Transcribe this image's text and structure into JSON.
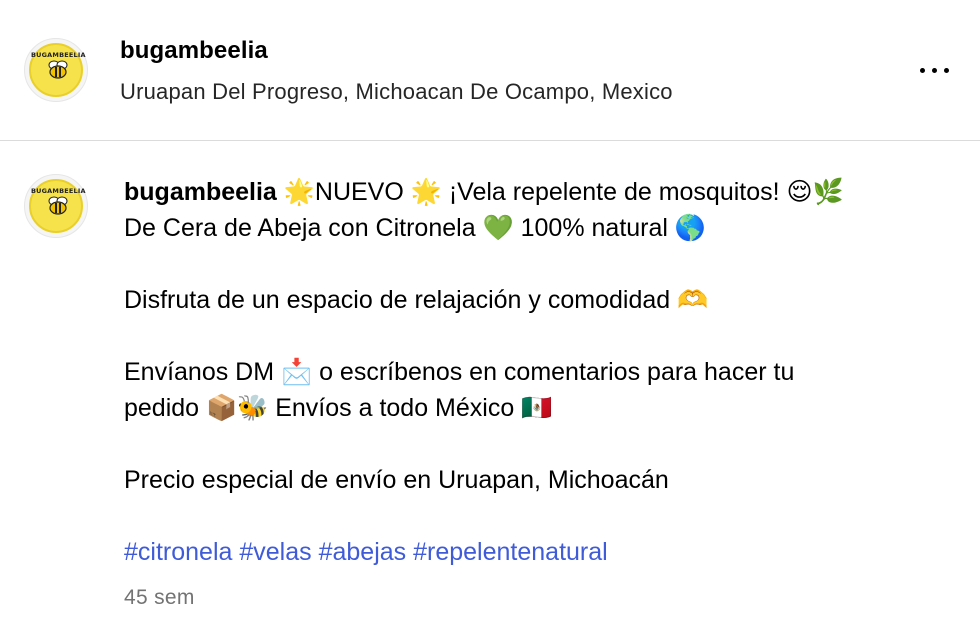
{
  "header": {
    "username": "bugambeelia",
    "location": "Uruapan Del Progreso, Michoacan De Ocampo, Mexico",
    "avatar_text": "BUGAMBEELIA"
  },
  "post": {
    "author": "bugambeelia",
    "avatar_text": "BUGAMBEELIA",
    "caption_lines": [
      " 🌟NUEVO 🌟 ¡Vela repelente de mosquitos! 😌🌿",
      "De Cera de Abeja con Citronela 💚 100% natural 🌎",
      "Disfruta de un espacio de relajación y comodidad 🫶",
      "Envíanos DM 📩 o escríbenos en comentarios para hacer tu",
      "pedido 📦🐝 Envíos a todo México 🇲🇽",
      "Precio especial de envío en Uruapan, Michoacán"
    ],
    "hashtags": [
      "#citronela",
      "#velas",
      "#abejas",
      "#repelentenatural"
    ],
    "timestamp": "45 sem"
  },
  "colors": {
    "hashtag": "#3f5bd8",
    "timestamp": "#737373",
    "avatar_yellow": "#f6e24a",
    "divider": "#dbdbdb"
  },
  "icons": {
    "more": "more-options-icon",
    "avatar": "bee-logo-icon"
  }
}
